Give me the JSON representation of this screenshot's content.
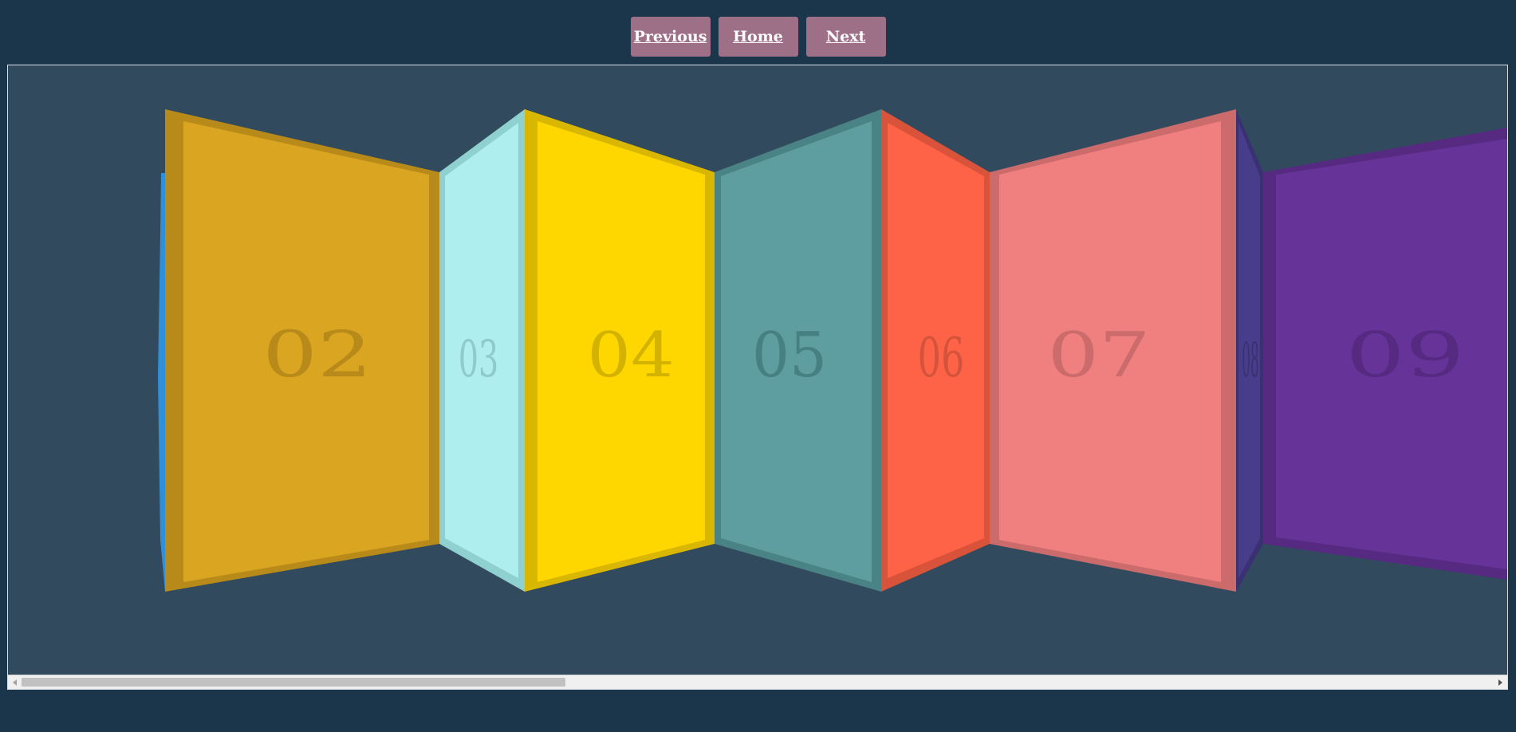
{
  "nav": {
    "previous_label": "Previous",
    "home_label": "Home",
    "next_label": "Next"
  },
  "panels": [
    {
      "label": "02",
      "face": "#daa520",
      "frame": "#b88a1a",
      "text_color": "#b88a1a"
    },
    {
      "label": "03",
      "face": "#afeeee",
      "frame": "#8fd0d0",
      "text_color": "#8fcbcb"
    },
    {
      "label": "04",
      "face": "#ffd700",
      "frame": "#d9b600",
      "text_color": "#d4b200"
    },
    {
      "label": "05",
      "face": "#5f9ea0",
      "frame": "#4a8385",
      "text_color": "#468082"
    },
    {
      "label": "06",
      "face": "#ff6347",
      "frame": "#d9533b",
      "text_color": "#d4533b"
    },
    {
      "label": "07",
      "face": "#f08080",
      "frame": "#cc6b6b",
      "text_color": "#cc6b6b"
    },
    {
      "label": "08",
      "face": "#483d8b",
      "frame": "#3a3172",
      "text_color": "#3a3172"
    },
    {
      "label": "09",
      "face": "#663399",
      "frame": "#552a80",
      "text_color": "#552a80"
    }
  ],
  "colors": {
    "page_bg": "#1b354b",
    "viewport_bg": "#324a5d",
    "button_bg": "#9e7088",
    "edge_panel": "#2f8fd9"
  }
}
